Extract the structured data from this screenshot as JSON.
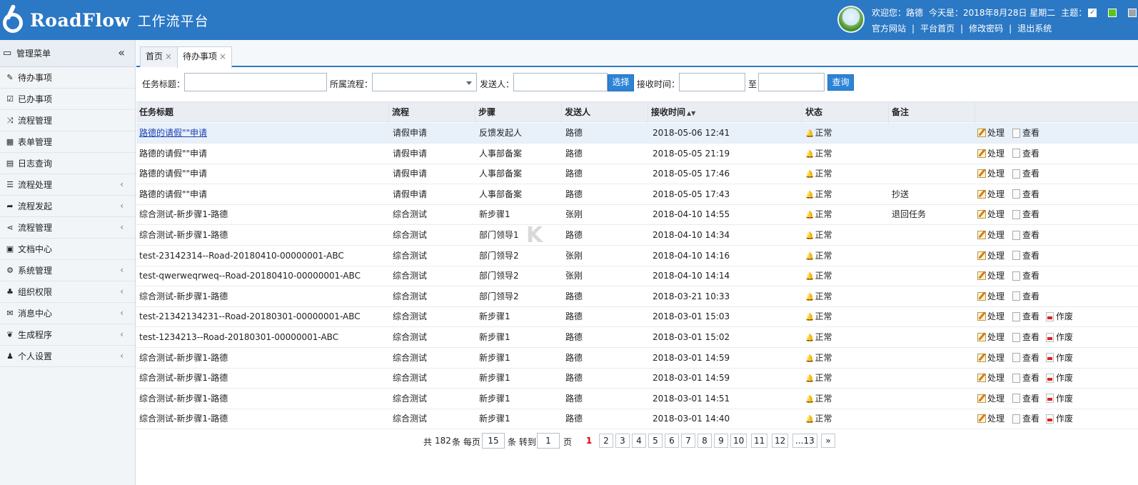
{
  "header": {
    "logo_text": "RoadFlow",
    "logo_sub": "工作流平台",
    "welcome": "欢迎您：路德",
    "today": "今天是：2018年8月28日 星期二",
    "theme_label": "主题：",
    "theme_colors": [
      "#ffffff",
      "#58c322",
      "#9aa4ad"
    ],
    "links": [
      "官方网站",
      "平台首页",
      "修改密码",
      "退出系统"
    ]
  },
  "sidebar": {
    "title": "管理菜单",
    "collapse_glyph": "«",
    "items": [
      {
        "label": "待办事项",
        "icon": "edit-icon",
        "glyph": "✎",
        "arrow": false
      },
      {
        "label": "已办事项",
        "icon": "checked-icon",
        "glyph": "☑",
        "arrow": false
      },
      {
        "label": "流程管理",
        "icon": "shuffle-icon",
        "glyph": "⤨",
        "arrow": false
      },
      {
        "label": "表单管理",
        "icon": "table-icon",
        "glyph": "▦",
        "arrow": false
      },
      {
        "label": "日志查询",
        "icon": "file-icon",
        "glyph": "▤",
        "arrow": false
      },
      {
        "label": "流程处理",
        "icon": "list-icon",
        "glyph": "☰",
        "arrow": true
      },
      {
        "label": "流程发起",
        "icon": "sign-in-icon",
        "glyph": "➦",
        "arrow": true
      },
      {
        "label": "流程管理",
        "icon": "share-icon",
        "glyph": "⋖",
        "arrow": true
      },
      {
        "label": "文档中心",
        "icon": "doc-icon",
        "glyph": "▣",
        "arrow": false
      },
      {
        "label": "系统管理",
        "icon": "gear-icon",
        "glyph": "⚙",
        "arrow": true
      },
      {
        "label": "组织权限",
        "icon": "sitemap-icon",
        "glyph": "♣",
        "arrow": true
      },
      {
        "label": "消息中心",
        "icon": "chat-icon",
        "glyph": "✉",
        "arrow": true
      },
      {
        "label": "生成程序",
        "icon": "leaf-icon",
        "glyph": "❦",
        "arrow": true
      },
      {
        "label": "个人设置",
        "icon": "user-icon",
        "glyph": "♟",
        "arrow": true
      }
    ]
  },
  "tabs": [
    {
      "label": "首页",
      "close": "×"
    },
    {
      "label": "待办事项",
      "close": "×"
    }
  ],
  "filters": {
    "title_label": "任务标题：",
    "flow_label": "所属流程：",
    "sender_label": "发送人：",
    "select_button": "选择",
    "time_label": "接收时间：",
    "to_label": "至",
    "query_button": "查询"
  },
  "table": {
    "columns": [
      "任务标题",
      "流程",
      "步骤",
      "发送人",
      "接收时间",
      "状态",
      "备注"
    ],
    "sort_glyph": "▲▼",
    "status_glyph": "🔔",
    "actions": {
      "process": "处理",
      "view": "查看",
      "void": "作废"
    },
    "rows": [
      {
        "title": "路德的请假\"\"申请",
        "flow": "请假申请",
        "step": "反馈发起人",
        "sender": "路德",
        "time": "2018-05-06 12:41",
        "status": "正常",
        "note": "",
        "void": false
      },
      {
        "title": "路德的请假\"\"申请",
        "flow": "请假申请",
        "step": "人事部备案",
        "sender": "路德",
        "time": "2018-05-05 21:19",
        "status": "正常",
        "note": "",
        "void": false
      },
      {
        "title": "路德的请假\"\"申请",
        "flow": "请假申请",
        "step": "人事部备案",
        "sender": "路德",
        "time": "2018-05-05 17:46",
        "status": "正常",
        "note": "",
        "void": false
      },
      {
        "title": "路德的请假\"\"申请",
        "flow": "请假申请",
        "step": "人事部备案",
        "sender": "路德",
        "time": "2018-05-05 17:43",
        "status": "正常",
        "note": "抄送",
        "void": false
      },
      {
        "title": "综合测试-新步骤1-路德",
        "flow": "综合测试",
        "step": "新步骤1",
        "sender": "张刚",
        "time": "2018-04-10 14:55",
        "status": "正常",
        "note": "退回任务",
        "void": false
      },
      {
        "title": "综合测试-新步骤1-路德",
        "flow": "综合测试",
        "step": "部门领导1",
        "sender": "路德",
        "time": "2018-04-10 14:34",
        "status": "正常",
        "note": "",
        "void": false
      },
      {
        "title": "test-23142314--Road-20180410-00000001-ABC",
        "flow": "综合测试",
        "step": "部门领导2",
        "sender": "张刚",
        "time": "2018-04-10 14:16",
        "status": "正常",
        "note": "",
        "void": false
      },
      {
        "title": "test-qwerweqrweq--Road-20180410-00000001-ABC",
        "flow": "综合测试",
        "step": "部门领导2",
        "sender": "张刚",
        "time": "2018-04-10 14:14",
        "status": "正常",
        "note": "",
        "void": false
      },
      {
        "title": "综合测试-新步骤1-路德",
        "flow": "综合测试",
        "step": "部门领导2",
        "sender": "路德",
        "time": "2018-03-21 10:33",
        "status": "正常",
        "note": "",
        "void": false
      },
      {
        "title": "test-21342134231--Road-20180301-00000001-ABC",
        "flow": "综合测试",
        "step": "新步骤1",
        "sender": "路德",
        "time": "2018-03-01 15:03",
        "status": "正常",
        "note": "",
        "void": true
      },
      {
        "title": "test-1234213--Road-20180301-00000001-ABC",
        "flow": "综合测试",
        "step": "新步骤1",
        "sender": "路德",
        "time": "2018-03-01 15:02",
        "status": "正常",
        "note": "",
        "void": true
      },
      {
        "title": "综合测试-新步骤1-路德",
        "flow": "综合测试",
        "step": "新步骤1",
        "sender": "路德",
        "time": "2018-03-01 14:59",
        "status": "正常",
        "note": "",
        "void": true
      },
      {
        "title": "综合测试-新步骤1-路德",
        "flow": "综合测试",
        "step": "新步骤1",
        "sender": "路德",
        "time": "2018-03-01 14:59",
        "status": "正常",
        "note": "",
        "void": true
      },
      {
        "title": "综合测试-新步骤1-路德",
        "flow": "综合测试",
        "step": "新步骤1",
        "sender": "路德",
        "time": "2018-03-01 14:51",
        "status": "正常",
        "note": "",
        "void": true
      },
      {
        "title": "综合测试-新步骤1-路德",
        "flow": "综合测试",
        "step": "新步骤1",
        "sender": "路德",
        "time": "2018-03-01 14:40",
        "status": "正常",
        "note": "",
        "void": true
      }
    ]
  },
  "pager": {
    "total_prefix": "共",
    "total": "182",
    "total_suffix": "条 每页",
    "per_page": "15",
    "goto_label": "条 转到",
    "goto_page": "1",
    "page_suffix": "页",
    "pages": [
      "1",
      "2",
      "3",
      "4",
      "5",
      "6",
      "7",
      "8",
      "9",
      "10",
      "11",
      "12",
      "...13",
      "»"
    ],
    "current": "1"
  },
  "watermark": "K"
}
